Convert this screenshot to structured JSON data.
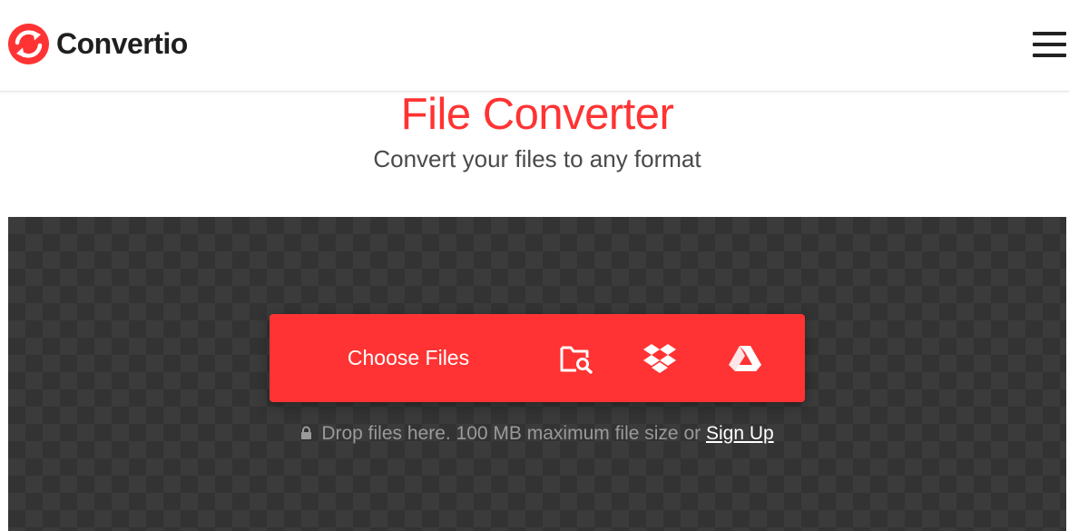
{
  "header": {
    "brand_name": "Convertio",
    "logo_icon": "convertio-arrows-logo",
    "menu_icon": "hamburger-menu-icon"
  },
  "hero": {
    "title": "File Converter",
    "subtitle": "Convert your files to any format"
  },
  "upload": {
    "choose_files_label": "Choose Files",
    "sources": [
      "folder-search-icon",
      "dropbox-icon",
      "google-drive-icon"
    ]
  },
  "hint": {
    "text": "Drop files here. 100 MB maximum file size or",
    "signup_label": "Sign Up",
    "lock_icon": "lock-icon"
  },
  "colors": {
    "accent": "#ff3333",
    "brand_text": "#1f1f1f",
    "drop_area": "#3b3b3b",
    "hint_text": "#9a9a9a"
  }
}
